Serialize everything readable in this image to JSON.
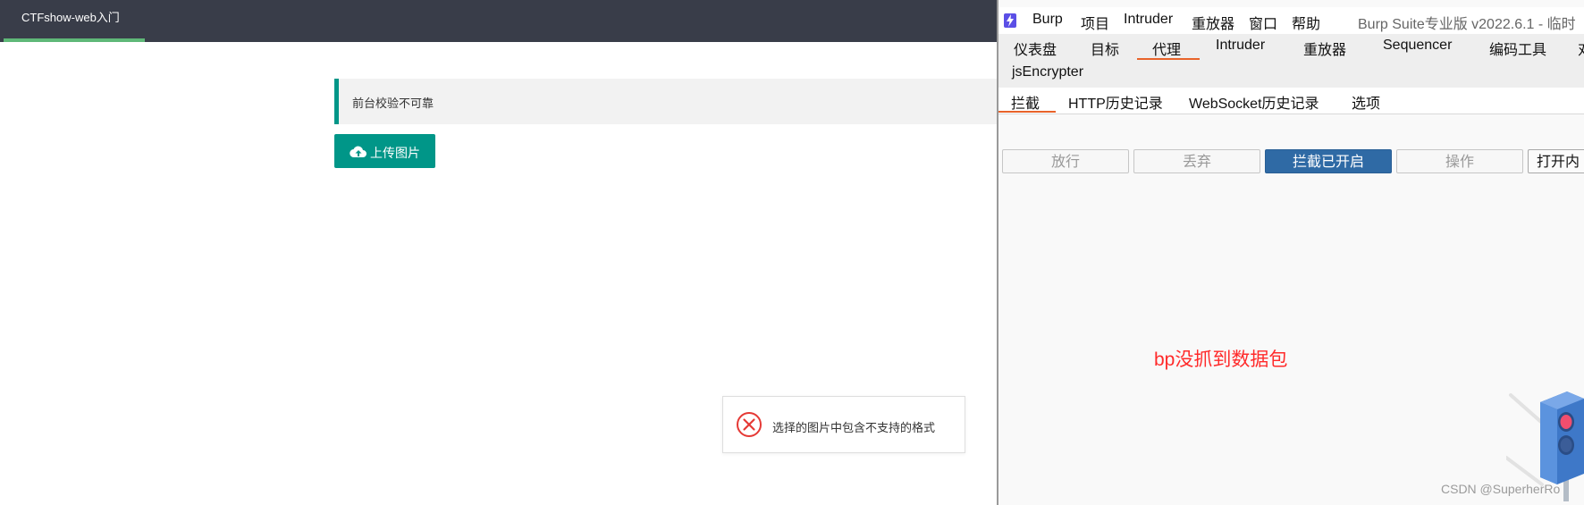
{
  "web": {
    "nav_tab": "CTFshow-web入门",
    "notice": "前台校验不可靠",
    "upload_button": "上传图片",
    "toast_message": "选择的图片中包含不支持的格式"
  },
  "burp": {
    "menu": [
      "Burp",
      "项目",
      "Intruder",
      "重放器",
      "窗口",
      "帮助"
    ],
    "title": "Burp Suite专业版  v2022.6.1 - 临时",
    "main_tabs": [
      "仪表盘",
      "目标",
      "代理",
      "Intruder",
      "重放器",
      "Sequencer",
      "编码工具",
      "对"
    ],
    "main_tab_active": "代理",
    "extension_tab": "jsEncrypter",
    "sub_tabs": [
      "拦截",
      "HTTP历史记录",
      "WebSocket历史记录",
      "选项"
    ],
    "sub_tab_active": "拦截",
    "buttons": {
      "forward": "放行",
      "drop": "丢弃",
      "intercept": "拦截已开启",
      "action": "操作",
      "open_browser": "打开内"
    }
  },
  "annotation": "bp没抓到数据包",
  "watermark": "CSDN @SuperherRo",
  "colors": {
    "accent_teal": "#009688",
    "nav_dark": "#393d49",
    "burp_orange": "#e8632a",
    "burp_blue": "#2f6aa5",
    "annotation_red": "#ff2a2a"
  }
}
